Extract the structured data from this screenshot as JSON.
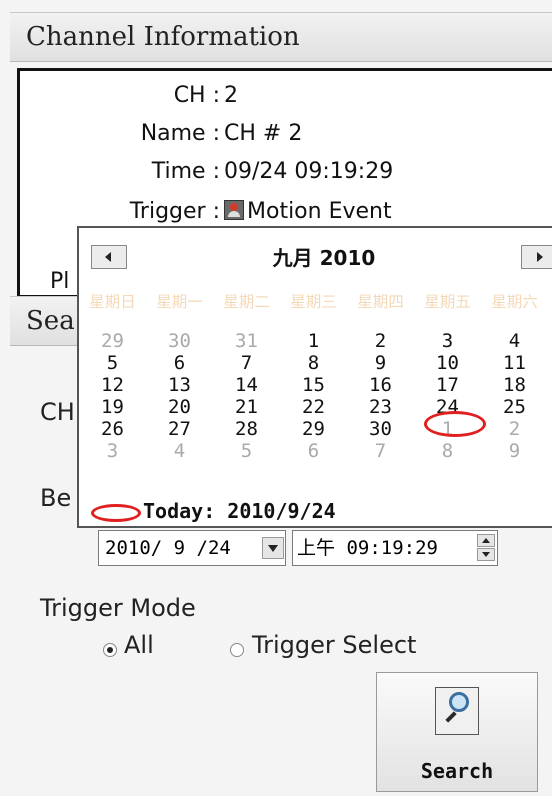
{
  "channel_info": {
    "title": "Channel Information",
    "ch_label": "CH :",
    "ch_value": "2",
    "name_label": "Name :",
    "name_value": "CH # 2",
    "time_label": "Time :",
    "time_value": "09/24 09:19:29",
    "trigger_label": "Trigger :",
    "trigger_value": "Motion Event",
    "play_label": "Pl"
  },
  "search": {
    "title": "Sea",
    "ch_label": "CH",
    "begin_label": "Be",
    "date_value": "2010/ 9 /24",
    "time_value": "上午 09:19:29",
    "trigger_mode_label": "Trigger Mode",
    "option_all": "All",
    "option_trigger_select": "Trigger Select",
    "selected_option": "All",
    "search_button_label": "Search"
  },
  "calendar": {
    "month_title": "九月 2010",
    "weekdays": [
      "星期日",
      "星期一",
      "星期二",
      "星期三",
      "星期四",
      "星期五",
      "星期六"
    ],
    "weeks": [
      [
        {
          "d": "29",
          "o": true
        },
        {
          "d": "30",
          "o": true
        },
        {
          "d": "31",
          "o": true
        },
        {
          "d": "1"
        },
        {
          "d": "2"
        },
        {
          "d": "3"
        },
        {
          "d": "4"
        }
      ],
      [
        {
          "d": "5"
        },
        {
          "d": "6"
        },
        {
          "d": "7"
        },
        {
          "d": "8"
        },
        {
          "d": "9"
        },
        {
          "d": "10"
        },
        {
          "d": "11"
        }
      ],
      [
        {
          "d": "12"
        },
        {
          "d": "13"
        },
        {
          "d": "14"
        },
        {
          "d": "15"
        },
        {
          "d": "16"
        },
        {
          "d": "17"
        },
        {
          "d": "18"
        }
      ],
      [
        {
          "d": "19"
        },
        {
          "d": "20"
        },
        {
          "d": "21"
        },
        {
          "d": "22"
        },
        {
          "d": "23"
        },
        {
          "d": "24",
          "today": true
        },
        {
          "d": "25"
        }
      ],
      [
        {
          "d": "26"
        },
        {
          "d": "27"
        },
        {
          "d": "28"
        },
        {
          "d": "29"
        },
        {
          "d": "30"
        },
        {
          "d": "1",
          "o": true
        },
        {
          "d": "2",
          "o": true
        }
      ],
      [
        {
          "d": "3",
          "o": true
        },
        {
          "d": "4",
          "o": true
        },
        {
          "d": "5",
          "o": true
        },
        {
          "d": "6",
          "o": true
        },
        {
          "d": "7",
          "o": true
        },
        {
          "d": "8",
          "o": true
        },
        {
          "d": "9",
          "o": true
        }
      ]
    ],
    "today_text": "Today: 2010/9/24",
    "colors": {
      "today_ring": "#e02020",
      "weekday_text": "#f4d9b8",
      "other_month": "#aaaaaa"
    }
  }
}
